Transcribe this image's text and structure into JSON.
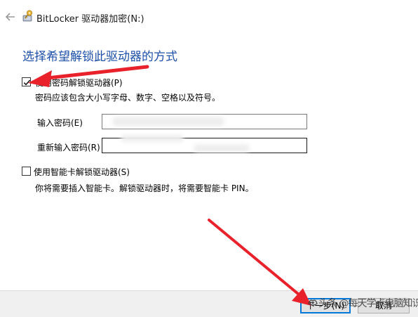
{
  "window": {
    "title": "BitLocker 驱动器加密(N:)"
  },
  "heading": "选择希望解锁此驱动器的方式",
  "password_option": {
    "label": "使用密码解锁驱动器(P)",
    "checked": true,
    "description": "密码应该包含大小写字母、数字、空格以及符号。",
    "enter_label": "输入密码(E)",
    "reenter_label": "重新输入密码(R)",
    "enter_value": "",
    "reenter_value": ""
  },
  "smartcard_option": {
    "label": "使用智能卡解锁驱动器(S)",
    "checked": false,
    "description": "你将需要插入智能卡。解锁驱动器时，将需要智能卡 PIN。"
  },
  "footer": {
    "next_label": "下一步(N)",
    "cancel_label": "取消"
  },
  "watermark": {
    "text": "头条 @每天学点电脑知识",
    "icon": "toutiao-logo-icon"
  },
  "colors": {
    "heading": "#1c4fa8",
    "annotation_arrow": "#e8212b",
    "focus_border": "#0078d7"
  },
  "icons": {
    "back": "back-arrow-icon",
    "app": "bitlocker-key-icon"
  }
}
